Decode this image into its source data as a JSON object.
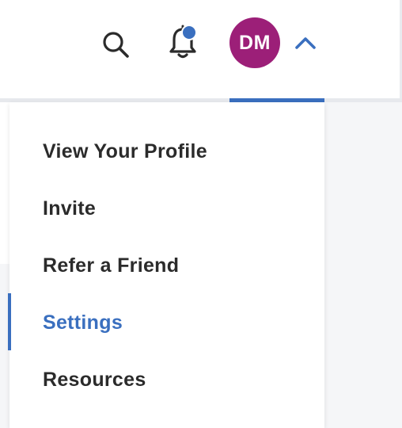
{
  "header": {
    "avatar_initials": "DM",
    "avatar_color": "#9c1f78",
    "accent_color": "#3a6fbf",
    "notification_dot": true,
    "icons": [
      "search-icon",
      "bell-icon",
      "chevron-up-icon"
    ]
  },
  "menu": {
    "items": [
      {
        "label": "View Your Profile",
        "active": false
      },
      {
        "label": "Invite",
        "active": false
      },
      {
        "label": "Refer a Friend",
        "active": false
      },
      {
        "label": "Settings",
        "active": true
      },
      {
        "label": "Resources",
        "active": false
      }
    ],
    "active_color": "#3a6fbf",
    "text_color": "#2b2b2b"
  }
}
